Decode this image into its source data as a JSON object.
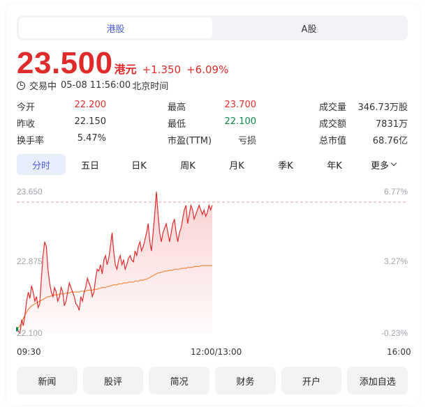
{
  "market_tabs": [
    {
      "label": "港股",
      "active": true
    },
    {
      "label": "A股",
      "active": false
    }
  ],
  "quote": {
    "price": "23.500",
    "currency": "港元",
    "change": "+1.350",
    "change_pct": "+6.09%",
    "status": "交易中",
    "date": "05-08",
    "time": "11:56:00",
    "timezone": "北京时间"
  },
  "stats": {
    "open_label": "今开",
    "open": "22.200",
    "high_label": "最高",
    "high": "23.700",
    "volume_label": "成交量",
    "volume": "346.73万股",
    "prev_close_label": "昨收",
    "prev_close": "22.150",
    "low_label": "最低",
    "low": "22.100",
    "turnover_label": "成交额",
    "turnover": "7831万",
    "turnover_rate_label": "换手率",
    "turnover_rate": "5.47%",
    "pe_label": "市盈(TTM)",
    "pe": "亏损",
    "market_cap_label": "总市值",
    "market_cap": "68.76亿"
  },
  "period_tabs": [
    {
      "label": "分时",
      "active": true
    },
    {
      "label": "五日"
    },
    {
      "label": "日K"
    },
    {
      "label": "周K"
    },
    {
      "label": "月K"
    },
    {
      "label": "季K"
    },
    {
      "label": "年K"
    },
    {
      "label": "更多"
    }
  ],
  "colors": {
    "up": "#e02b2b",
    "down": "#0a8a4a",
    "accent": "#4b5fd6",
    "avg_line": "#f08a3c"
  },
  "chart_data": {
    "type": "line",
    "y_left_ticks": [
      "23.650",
      "22.875",
      "22.100"
    ],
    "y_right_ticks": [
      "6.77%",
      "3.27%",
      "-0.23%"
    ],
    "x_ticks": [
      "09:30",
      "12:00/13:00",
      "16:00"
    ],
    "ylim": [
      22.1,
      23.65
    ],
    "prev_close": 22.15,
    "session_points": 120,
    "series": [
      {
        "values": [
          22.15,
          22.12,
          22.1,
          22.25,
          22.18,
          22.3,
          22.45,
          22.55,
          22.48,
          22.62,
          22.55,
          22.45,
          22.5,
          22.38,
          22.42,
          22.7,
          22.95,
          23.1,
          23.05,
          22.8,
          22.65,
          22.55,
          22.5,
          22.6,
          22.55,
          22.45,
          22.5,
          22.6,
          22.55,
          22.4,
          22.45,
          22.55,
          22.65,
          22.6,
          22.55,
          22.5,
          22.42,
          22.4,
          22.35,
          22.5,
          22.45,
          22.55,
          22.6,
          22.7,
          22.65,
          22.6,
          22.5,
          22.55,
          22.7,
          22.8,
          22.78,
          22.85,
          22.75,
          22.9,
          22.95,
          22.85,
          22.92,
          23.05,
          23.2,
          23.0,
          22.85,
          22.8,
          22.9,
          22.95,
          22.85,
          22.9,
          22.8,
          22.85,
          22.92,
          22.95,
          22.9,
          22.88,
          23.0,
          22.95,
          23.05,
          23.1,
          23.0,
          23.05,
          23.12,
          23.2,
          23.3,
          23.1,
          23.0,
          23.2,
          23.4,
          23.65,
          23.4,
          23.2,
          23.1,
          23.2,
          23.25,
          23.3,
          23.2,
          23.1,
          23.2,
          23.3,
          23.35,
          23.2,
          23.1,
          23.2,
          23.25,
          23.35,
          23.45,
          23.5,
          23.3,
          23.4,
          23.5,
          23.45,
          23.35,
          23.4,
          23.45,
          23.5,
          23.45,
          23.4,
          23.45,
          23.38,
          23.42,
          23.5,
          23.45,
          23.5
        ]
      },
      {
        "values": [
          22.15,
          22.16,
          22.18,
          22.22,
          22.26,
          22.3,
          22.33,
          22.36,
          22.38,
          22.4,
          22.41,
          22.42,
          22.43,
          22.44,
          22.45,
          22.46,
          22.47,
          22.48,
          22.49,
          22.5,
          22.5,
          22.51,
          22.51,
          22.52,
          22.52,
          22.52,
          22.53,
          22.53,
          22.53,
          22.53,
          22.54,
          22.54,
          22.54,
          22.55,
          22.55,
          22.55,
          22.55,
          22.55,
          22.55,
          22.56,
          22.56,
          22.56,
          22.56,
          22.57,
          22.57,
          22.57,
          22.57,
          22.58,
          22.58,
          22.58,
          22.59,
          22.59,
          22.6,
          22.6,
          22.6,
          22.61,
          22.61,
          22.62,
          22.62,
          22.63,
          22.63,
          22.63,
          22.64,
          22.64,
          22.64,
          22.65,
          22.65,
          22.65,
          22.66,
          22.66,
          22.66,
          22.66,
          22.67,
          22.67,
          22.67,
          22.68,
          22.68,
          22.68,
          22.69,
          22.69,
          22.7,
          22.71,
          22.72,
          22.73,
          22.74,
          22.75,
          22.76,
          22.76,
          22.77,
          22.77,
          22.78,
          22.78,
          22.78,
          22.79,
          22.79,
          22.79,
          22.8,
          22.8,
          22.8,
          22.8,
          22.81,
          22.81,
          22.81,
          22.81,
          22.82,
          22.82,
          22.82,
          22.82,
          22.83,
          22.83,
          22.83,
          22.83,
          22.84,
          22.84,
          22.84,
          22.84,
          22.84,
          22.84,
          22.84,
          22.84
        ]
      }
    ]
  },
  "actions": [
    "新闻",
    "股评",
    "简况",
    "财务",
    "开户",
    "添加自选"
  ]
}
